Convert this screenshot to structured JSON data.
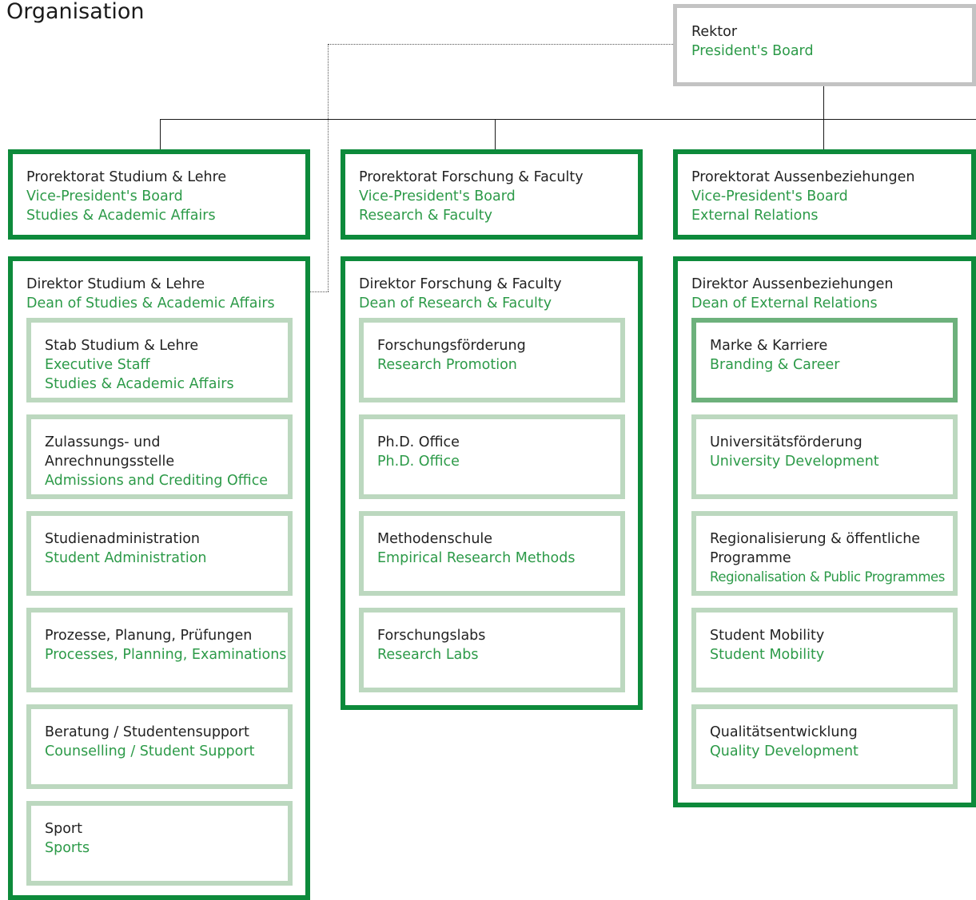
{
  "page": {
    "title": "Organisation"
  },
  "colors": {
    "primary_border": "#0d8a3b",
    "unit_border": "#bcd8bf",
    "highlight_border": "#6db17c",
    "president_border": "#c3c3c3",
    "english_text": "#2c9a48",
    "german_text": "#222222"
  },
  "president": {
    "de": "Rektor",
    "en": "President's Board"
  },
  "vice_presidents": [
    {
      "de": "Prorektorat Studium & Lehre",
      "en": "Vice-President's Board\nStudies & Academic Affairs"
    },
    {
      "de": "Prorektorat Forschung & Faculty",
      "en": "Vice-President's Board\nResearch & Faculty"
    },
    {
      "de": "Prorektorat Aussenbeziehungen",
      "en": "Vice-President's Board\nExternal Relations"
    }
  ],
  "directors": [
    {
      "de": "Direktor Studium & Lehre",
      "en": "Dean of Studies & Academic Affairs",
      "units": [
        {
          "de": "Stab Studium & Lehre",
          "en": "Executive Staff\nStudies & Academic Affairs"
        },
        {
          "de": "Zulassungs- und\nAnrechnungsstelle",
          "en": "Admissions and Crediting Office"
        },
        {
          "de": "Studienadministration",
          "en": "Student Administration"
        },
        {
          "de": "Prozesse, Planung, Prüfungen",
          "en": "Processes, Planning, Examinations"
        },
        {
          "de": "Beratung / Studentensupport",
          "en": "Counselling / Student Support"
        },
        {
          "de": "Sport",
          "en": "Sports"
        }
      ]
    },
    {
      "de": "Direktor Forschung & Faculty",
      "en": "Dean of Research & Faculty",
      "units": [
        {
          "de": "Forschungsförderung",
          "en": "Research Promotion"
        },
        {
          "de": "Ph.D. Office",
          "en": "Ph.D. Office"
        },
        {
          "de": "Methodenschule",
          "en": "Empirical Research Methods"
        },
        {
          "de": "Forschungslabs",
          "en": "Research Labs"
        }
      ]
    },
    {
      "de": "Direktor Aussenbeziehungen",
      "en": "Dean of External Relations",
      "units": [
        {
          "de": "Marke & Karriere",
          "en": "Branding & Career"
        },
        {
          "de": "Universitätsförderung",
          "en": "University Development"
        },
        {
          "de": "Regionalisierung & öffentliche\nProgramme",
          "en": "Regionalisation & Public Programmes"
        },
        {
          "de": "Student Mobility",
          "en": "Student Mobility"
        },
        {
          "de": "Qualitätsentwicklung",
          "en": "Quality Development"
        }
      ]
    }
  ]
}
